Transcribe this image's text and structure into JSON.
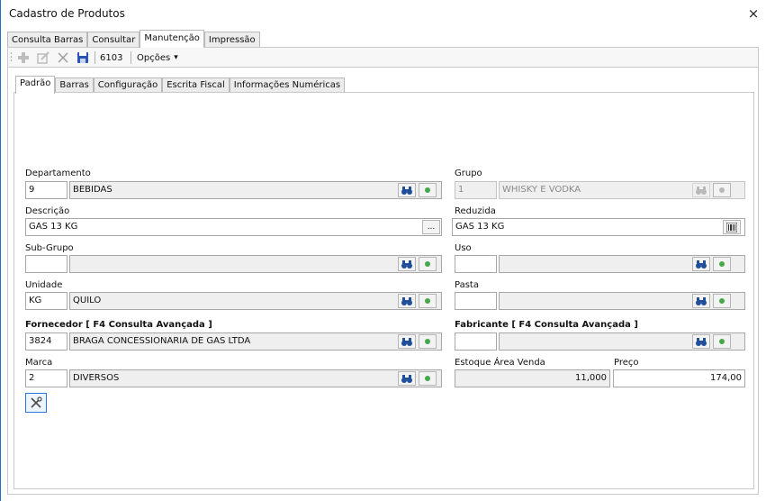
{
  "window": {
    "title": "Cadastro de Produtos",
    "close_glyph": "×"
  },
  "main_tabs": [
    {
      "label": "Consulta Barras"
    },
    {
      "label": "Consultar"
    },
    {
      "label": "Manutenção",
      "active": true
    },
    {
      "label": "Impressão"
    }
  ],
  "toolbar": {
    "icons": [
      "add-icon",
      "edit-icon",
      "delete-icon",
      "save-icon"
    ],
    "code": "6103",
    "options_label": "Opções",
    "options_caret": "▾"
  },
  "sub_tabs": [
    {
      "label": "Padrão",
      "active": true
    },
    {
      "label": "Barras"
    },
    {
      "label": "Configuração"
    },
    {
      "label": "Escrita Fiscal"
    },
    {
      "label": "Informações Numéricas"
    }
  ],
  "form": {
    "departamento": {
      "label": "Departamento",
      "code": "9",
      "name": "BEBIDAS"
    },
    "grupo": {
      "label": "Grupo",
      "code": "1",
      "name": "WHISKY E VODKA"
    },
    "descricao": {
      "label": "Descrição",
      "value": "GAS 13 KG",
      "btn": "..."
    },
    "reduzida": {
      "label": "Reduzida",
      "value": "GAS 13 KG"
    },
    "sub_grupo": {
      "label": "Sub-Grupo",
      "code": "",
      "name": ""
    },
    "uso": {
      "label": "Uso",
      "code": "",
      "name": ""
    },
    "unidade": {
      "label": "Unidade",
      "code": "KG",
      "name": "QUILO"
    },
    "pasta": {
      "label": "Pasta",
      "code": "",
      "name": ""
    },
    "fornecedor": {
      "label": "Fornecedor [ F4 Consulta Avançada ]",
      "code": "3824",
      "name": "BRAGA CONCESSIONARIA DE GAS LTDA"
    },
    "fabricante": {
      "label": "Fabricante [ F4 Consulta Avançada ]",
      "code": "",
      "name": ""
    },
    "marca": {
      "label": "Marca",
      "code": "2",
      "name": "DIVERSOS"
    },
    "estoque": {
      "label": "Estoque Área Venda",
      "value": "11,000"
    },
    "preco": {
      "label": "Preço",
      "value": "174,00"
    }
  },
  "colors": {
    "accent": "#1a73c8",
    "green": "#46a84a",
    "binoculars": "#1f4e9a"
  }
}
